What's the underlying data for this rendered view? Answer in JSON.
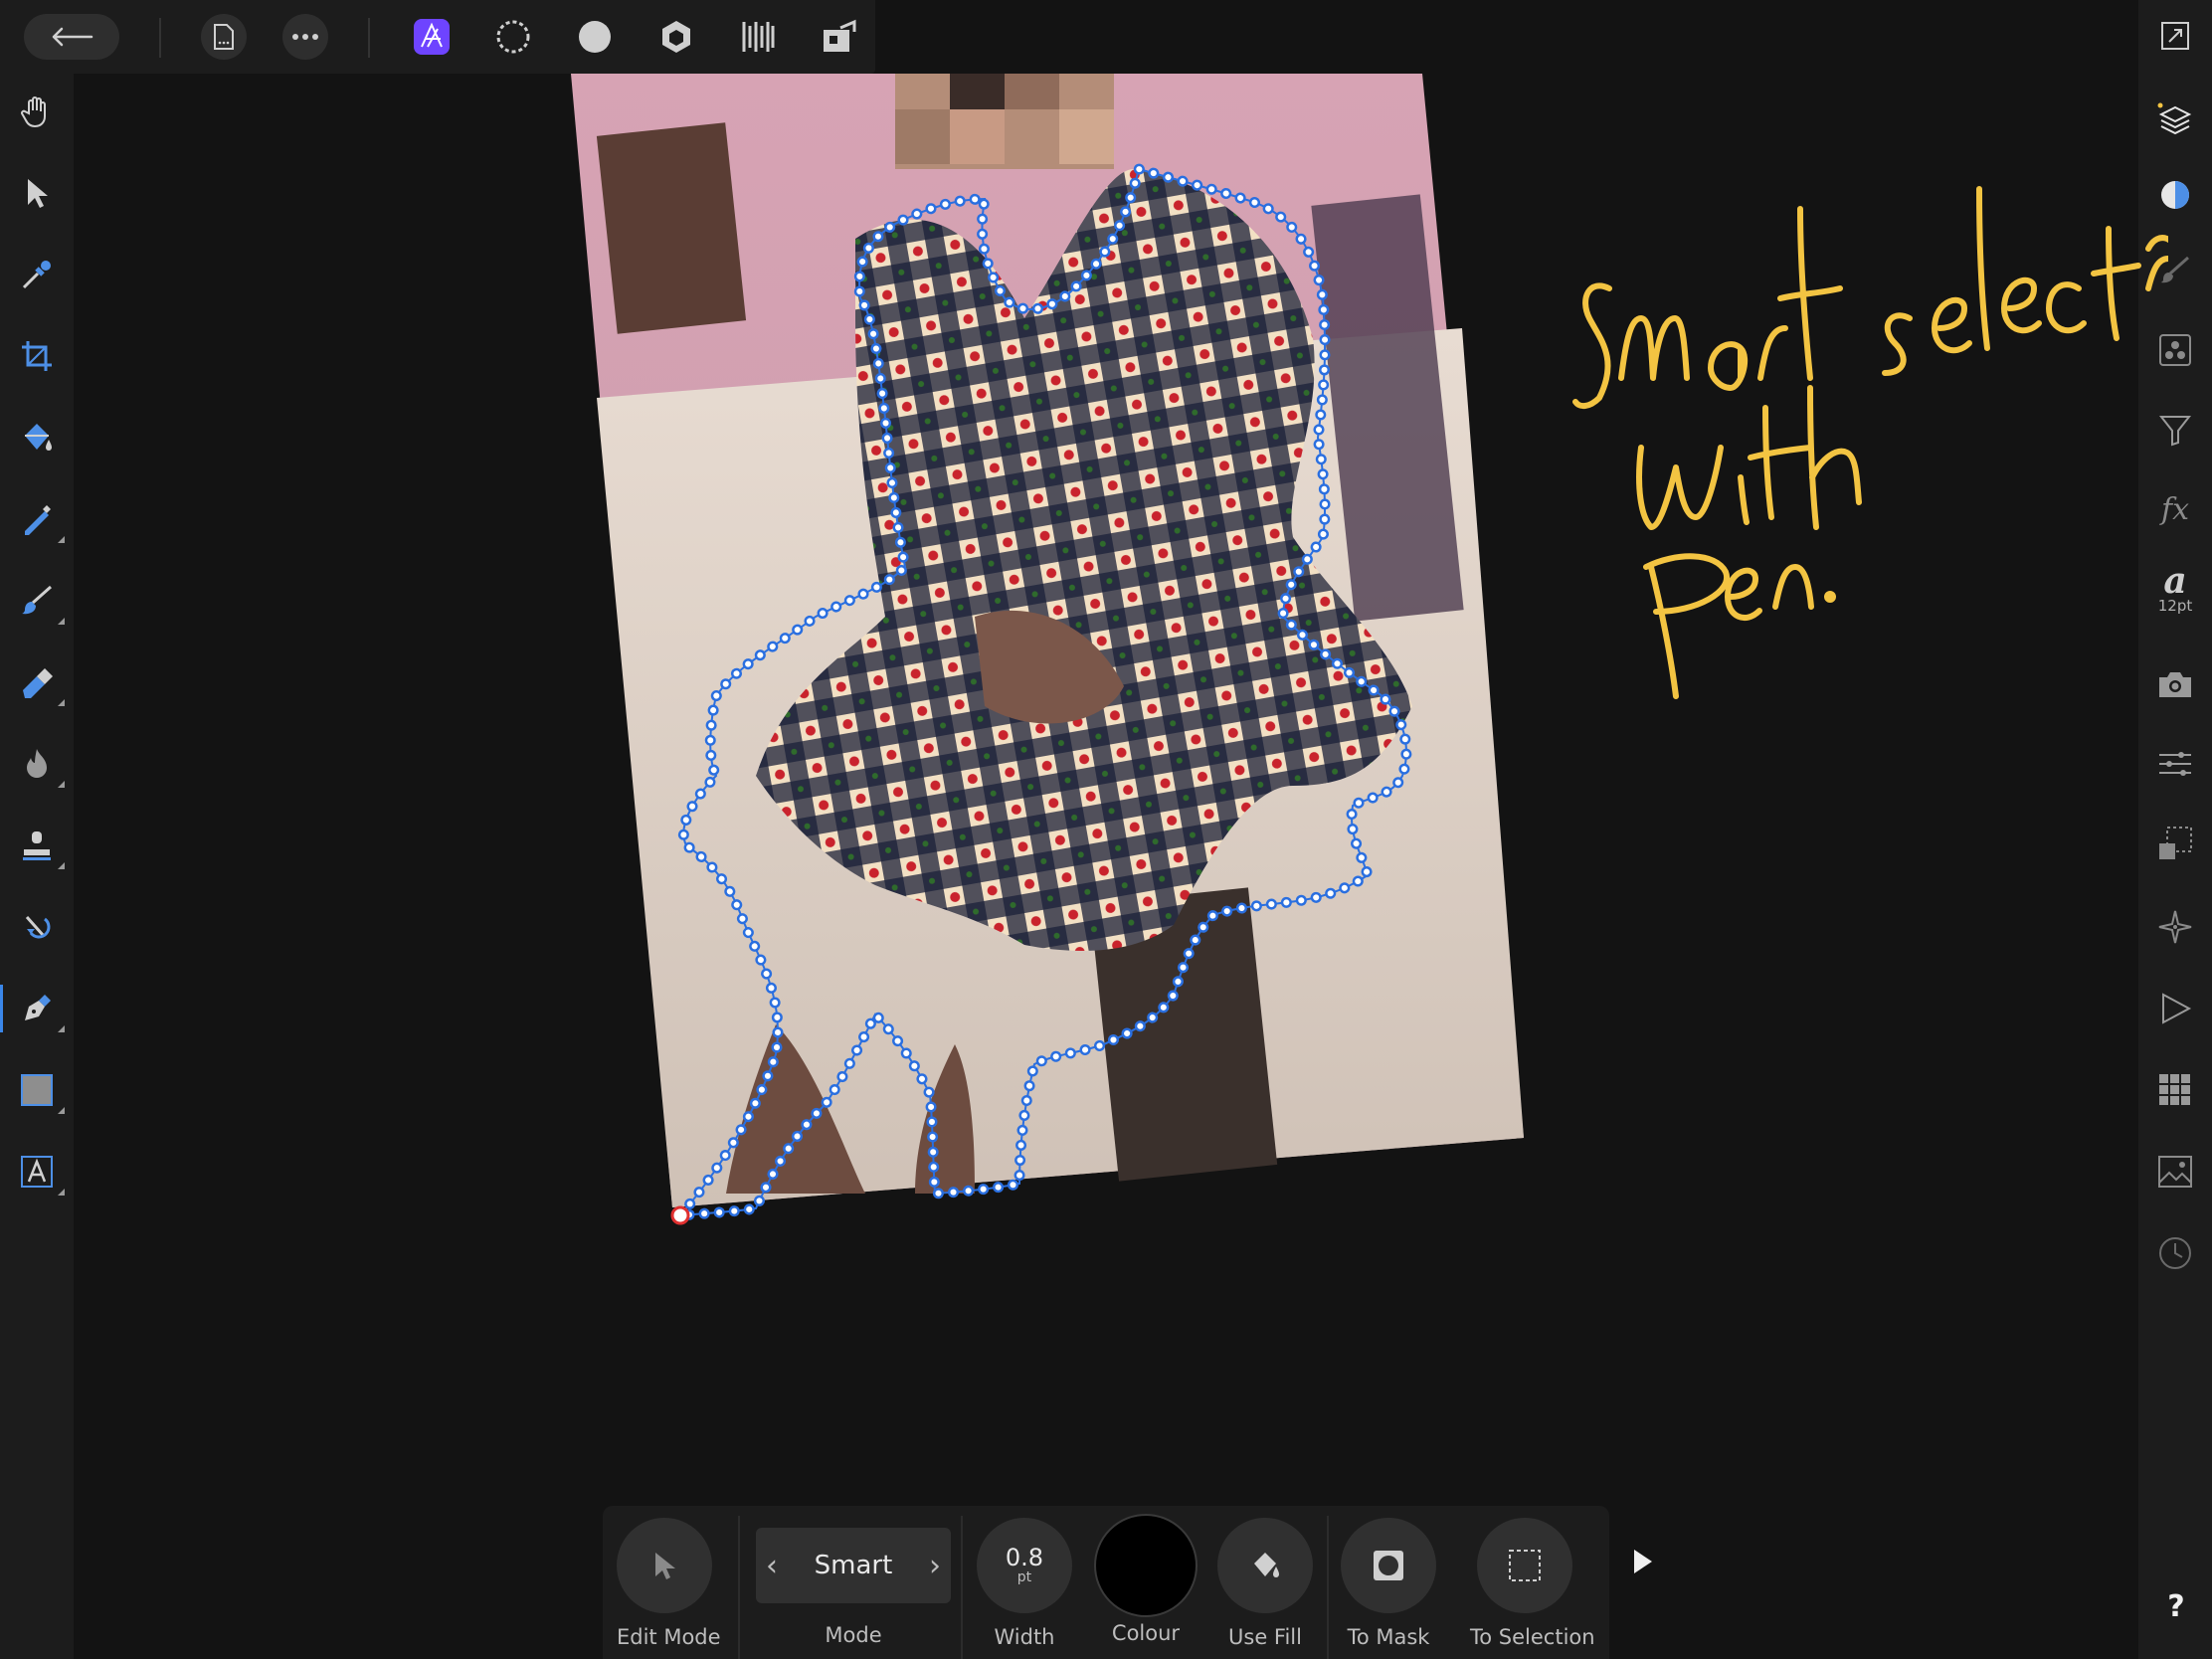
{
  "colors": {
    "panel": "#1c1c1c",
    "canvas": "#131313",
    "accent": "#3a86e8",
    "affinity_purple": "#6e44ff",
    "annotation_yellow": "#f3c442",
    "path_blue": "#2a6fe0"
  },
  "topbar": {
    "back_icon": "arrow-left-icon",
    "document_icon": "document-icon",
    "more_icon": "ellipsis-icon",
    "personas": [
      "photo-persona-icon",
      "selection-persona-icon",
      "tone-mapping-persona-icon",
      "develop-persona-icon",
      "liquify-persona-icon",
      "export-persona-icon"
    ]
  },
  "left_tools": [
    "hand-icon",
    "move-icon",
    "color-picker-icon",
    "crop-icon",
    "flood-fill-icon",
    "selection-brush-icon",
    "paint-brush-icon",
    "erase-brush-icon",
    "burn-brush-icon",
    "clone-brush-icon",
    "undo-brush-icon",
    "pen-icon",
    "rectangle-icon",
    "text-icon"
  ],
  "right_tools": {
    "items": [
      "fullscreen-icon",
      "layers-icon",
      "colour-icon",
      "brushes-icon",
      "adjustments-icon",
      "filters-icon",
      "fx-icon",
      "text-style-icon",
      "snapshots-icon",
      "transform-icon",
      "navigator-icon",
      "macro-icon",
      "history-grid-icon",
      "stock-icon",
      "history-icon"
    ],
    "text_size": "12pt",
    "fx_label": "fx",
    "text_style_label": "a"
  },
  "context_toolbar": {
    "edit_mode": "Edit Mode",
    "mode_value": "Smart",
    "mode_label": "Mode",
    "width_value": "0.8",
    "width_unit": "pt",
    "width_label": "Width",
    "colour_label": "Colour",
    "use_fill_label": "Use Fill",
    "to_mask_label": "To Mask",
    "to_selection_label": "To Selection"
  },
  "help_label": "?"
}
